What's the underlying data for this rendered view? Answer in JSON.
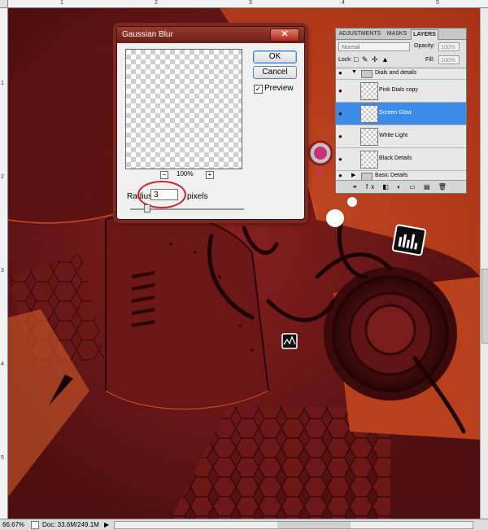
{
  "rulers": {
    "top_ticks": [
      "1",
      "2",
      "3",
      "4",
      "5"
    ],
    "left_ticks": [
      "1",
      "2",
      "3",
      "4",
      "5"
    ]
  },
  "status_bar": {
    "zoom": "66.67%",
    "doc": "Doc: 33.6M/249.1M",
    "arrow": "▶"
  },
  "gaussian_blur": {
    "title": "Gaussian Blur",
    "close_label": "✕",
    "ok_label": "OK",
    "cancel_label": "Cancel",
    "preview_checked": "✓",
    "preview_label": "Preview",
    "zoom_minus": "−",
    "zoom_plus": "+",
    "zoom_percent": "100%",
    "radius_label": "Radius:",
    "radius_value": "3",
    "pixels_label": "pixels"
  },
  "layers_panel": {
    "tabs": [
      "ADJUSTMENTS",
      "MASKS",
      "LAYERS"
    ],
    "blend_mode": "Normal",
    "opacity_label": "Opacity:",
    "opacity_value": "100%",
    "lock_label": "Lock:",
    "lock_icons": "□ ✎ ✢ ▲",
    "fill_label": "Fill:",
    "fill_value": "100%",
    "group_name": "Dials and details",
    "layers": [
      {
        "name": "Pink Dials copy"
      },
      {
        "name": "Screen Glow"
      },
      {
        "name": "White Light"
      },
      {
        "name": "Black Details"
      }
    ],
    "bottom_group": "Basic Details",
    "footer_icons": "⚭ fx ◧ ◐ ▭ ▤ 🗑"
  },
  "colors": {
    "canvas_base": "#b33a1a",
    "selected_layer": "#3d8be8",
    "highlight_circle": "#d0202a"
  }
}
